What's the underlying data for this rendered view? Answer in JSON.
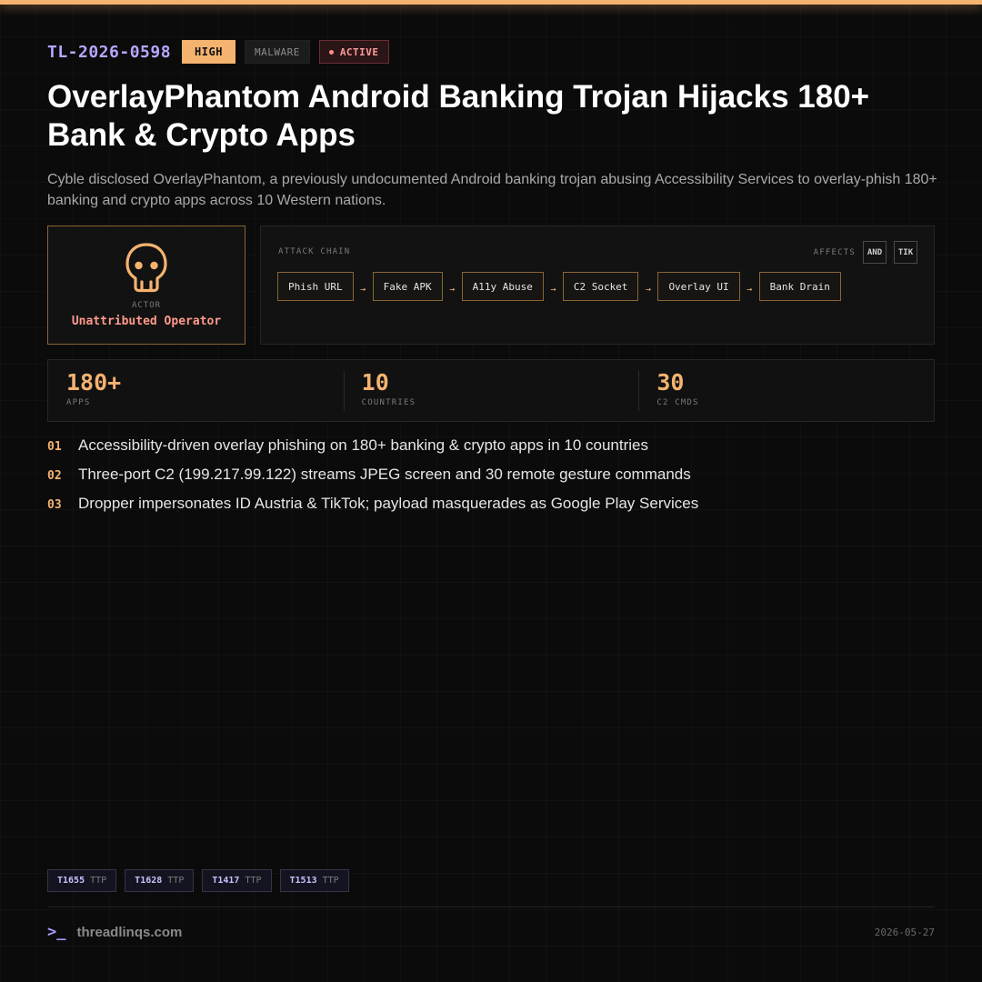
{
  "header": {
    "id": "TL-2026-0598",
    "severity": "HIGH",
    "category": "MALWARE",
    "status": "ACTIVE"
  },
  "title": "OverlayPhantom Android Banking Trojan Hijacks 180+ Bank & Crypto Apps",
  "description": "Cyble disclosed OverlayPhantom, a previously undocumented Android banking trojan abusing Accessibility Services to overlay-phish 180+ banking and crypto apps across 10 Western nations.",
  "actor": {
    "icon": "skull-icon",
    "label": "ACTOR",
    "name": "Unattributed Operator"
  },
  "attack_chain": {
    "label": "ATTACK CHAIN",
    "affects_label": "AFFECTS",
    "platforms": [
      "AND",
      "TIK"
    ],
    "steps": [
      "Phish URL",
      "Fake APK",
      "A11y Abuse",
      "C2 Socket",
      "Overlay UI",
      "Bank Drain"
    ],
    "arrow": "→"
  },
  "stats": [
    {
      "value": "180+",
      "label": "APPS"
    },
    {
      "value": "10",
      "label": "COUNTRIES"
    },
    {
      "value": "30",
      "label": "C2 CMDS"
    }
  ],
  "points": [
    {
      "num": "01",
      "text": "Accessibility-driven overlay phishing on 180+ banking & crypto apps in 10 countries"
    },
    {
      "num": "02",
      "text": "Three-port C2 (199.217.99.122) streams JPEG screen and 30 remote gesture commands"
    },
    {
      "num": "03",
      "text": "Dropper impersonates ID Austria & TikTok; payload masquerades as Google Play Services"
    }
  ],
  "ttps": [
    {
      "code": "T1655",
      "tag": "TTP"
    },
    {
      "code": "T1628",
      "tag": "TTP"
    },
    {
      "code": "T1417",
      "tag": "TTP"
    },
    {
      "code": "T1513",
      "tag": "TTP"
    }
  ],
  "footer": {
    "prompt": ">_",
    "site": "threadlinqs.com",
    "date": "2026-05-27"
  },
  "colors": {
    "accent": "#f5b370",
    "id": "#b9a6ff",
    "danger": "#ff9a8c"
  }
}
